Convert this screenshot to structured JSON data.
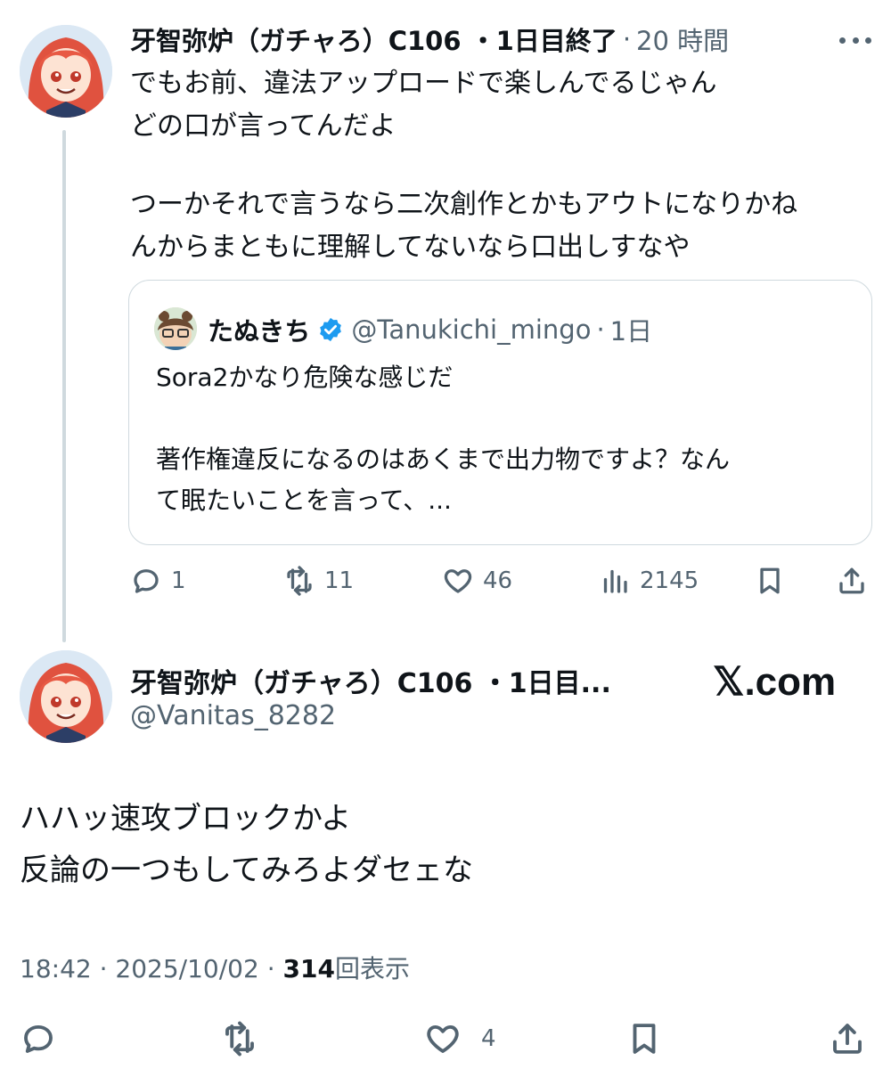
{
  "tweet1": {
    "display_name": "牙智弥炉（ガチャろ）C106 ・1日目終了",
    "separator": "·",
    "timestamp": "20 時間",
    "more_icon": "more-horizontal-icon",
    "text_lines": [
      "でもお前、違法アップロードで楽しんでるじゃん",
      "どの口が言ってんだよ",
      "",
      "つーかそれで言うなら二次創作とかもアウトになりかね",
      "んからまともに理解してないなら口出しすなや"
    ],
    "quote": {
      "display_name": "たぬきち",
      "verified_icon": "verified-badge-icon",
      "handle": "@Tanukichi_mingo",
      "separator": "·",
      "timestamp": "1日",
      "text_lines": [
        "Sora2かなり危険な感じだ",
        "",
        "著作権違反になるのはあくまで出力物ですよ？なん",
        "て眠たいことを言って、..."
      ]
    },
    "actions": {
      "reply_count": "1",
      "retweet_count": "11",
      "like_count": "46",
      "views_count": "2145"
    }
  },
  "tweet2": {
    "display_name": "牙智弥炉（ガチャろ）C106 ・1日目...",
    "handle": "@Vanitas_8282",
    "brand": "𝕏.com",
    "text_lines": [
      "ハハッ速攻ブロックかよ",
      "反論の一つもしてみろよダセェな"
    ],
    "meta": {
      "time": "18:42",
      "sep1": "·",
      "date": "2025/10/02",
      "sep2": "·",
      "views": "314",
      "views_label": "回表示"
    },
    "actions": {
      "like_count": "4"
    }
  },
  "colors": {
    "text": "#0f1419",
    "secondary": "#536471",
    "border": "#cfd9de",
    "verified": "#1d9bf0"
  }
}
